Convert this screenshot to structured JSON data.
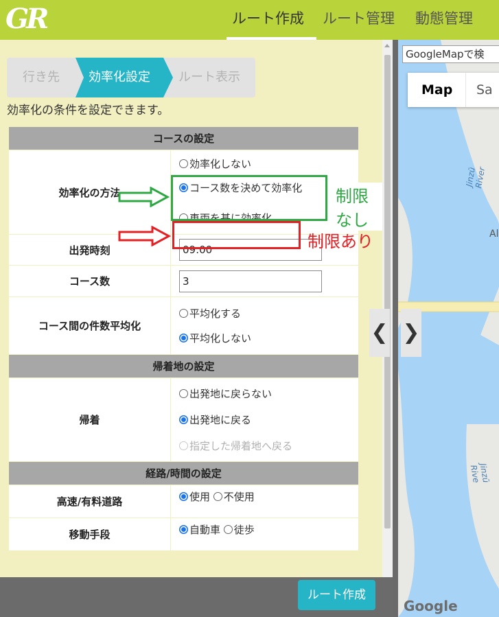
{
  "header": {
    "logo": "GR",
    "nav": [
      {
        "label": "ルート作成",
        "active": true
      },
      {
        "label": "ルート管理",
        "active": false
      },
      {
        "label": "動態管理",
        "active": false
      }
    ]
  },
  "steps": [
    "行き先",
    "効率化設定",
    "ルート表示"
  ],
  "intro": "効率化の条件を設定できます。",
  "sections": {
    "course": "コースの設定",
    "return": "帰着地の設定",
    "route": "経路/時間の設定"
  },
  "rows": {
    "method": {
      "label": "効率化の方法",
      "options": [
        "効率化しない",
        "コース数を決めて効率化",
        "車両を基に効率化"
      ]
    },
    "departure": {
      "label": "出発時刻",
      "value": "09:00"
    },
    "course_count": {
      "label": "コース数",
      "value": "3"
    },
    "balance": {
      "label": "コース間の件数平均化",
      "options": [
        "平均化する",
        "平均化しない"
      ]
    },
    "return": {
      "label": "帰着",
      "options": [
        "出発地に戻らない",
        "出発地に戻る",
        "指定した帰着地へ戻る"
      ]
    },
    "highway": {
      "label": "高速/有料道路",
      "options": [
        "使用",
        "不使用"
      ]
    },
    "transport": {
      "label": "移動手段",
      "options": [
        "自動車",
        "徒歩"
      ]
    }
  },
  "annotations": {
    "no_limit": "制限なし",
    "limited": "制限あり"
  },
  "footer": {
    "create_button": "ルート作成"
  },
  "map": {
    "search_placeholder": "GoogleMapで検",
    "map_button": "Map",
    "satellite_button": "Sa",
    "river_label_1": "Jinzū River",
    "river_label_2": "Jinzū Rive",
    "place_label": "Al",
    "collapse_left": "❮",
    "collapse_right": "❯",
    "google": "Google"
  },
  "colors": {
    "header": "#b9d43a",
    "panel": "#f2efc1",
    "accent": "#26b5c7",
    "annotation_green": "#2da843",
    "annotation_red": "#e32024"
  }
}
